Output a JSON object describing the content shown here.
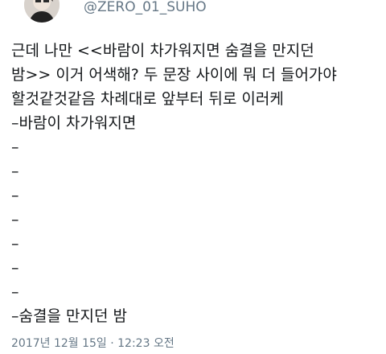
{
  "tweet": {
    "handle": "@ZERO_01_SUHO",
    "lines": [
      "근데 나만 <<바람이 차가워지면 숨결을 만지던",
      "밤>> 이거 어색해? 두 문장 사이에 뭐 더 들어가야",
      "할것같것같음 차례대로 앞부터 뒤로 이러케",
      "–바람이 차가워지면",
      "–",
      "–",
      "–",
      "–",
      "–",
      "–",
      "–",
      "–숨결을 만지던 밤"
    ],
    "timestamp": "2017년 12월 15일 · 12:23 오전"
  },
  "icons": {
    "avatar": "profile-avatar"
  },
  "colors": {
    "text": "#14171a",
    "secondary": "#657786",
    "background": "#ffffff"
  }
}
